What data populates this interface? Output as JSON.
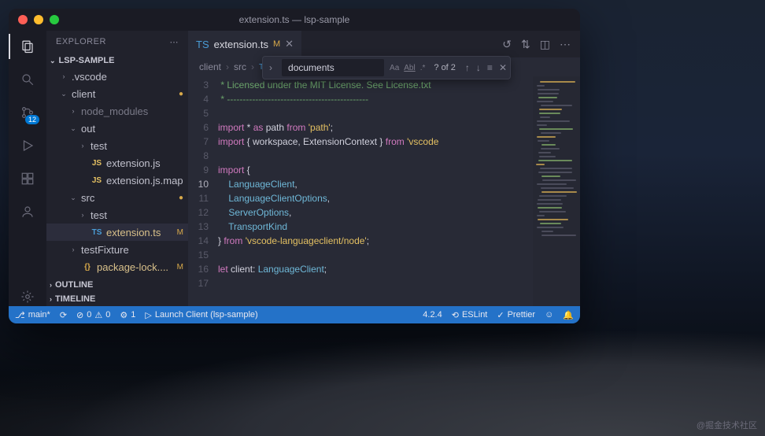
{
  "window": {
    "title": "extension.ts — lsp-sample"
  },
  "explorer": {
    "title": "EXPLORER",
    "project": "LSP-SAMPLE",
    "tree": [
      {
        "depth": 1,
        "chev": "›",
        "label": ".vscode",
        "type": "fld"
      },
      {
        "depth": 1,
        "chev": "⌄",
        "label": "client",
        "type": "fld",
        "mod": true,
        "dot": true
      },
      {
        "depth": 2,
        "chev": "›",
        "label": "node_modules",
        "type": "fld",
        "dim": true
      },
      {
        "depth": 2,
        "chev": "⌄",
        "label": "out",
        "type": "fld"
      },
      {
        "depth": 3,
        "chev": "›",
        "label": "test",
        "type": "fld"
      },
      {
        "depth": 3,
        "icon": "JS",
        "label": "extension.js",
        "type": "js"
      },
      {
        "depth": 3,
        "icon": "JS",
        "label": "extension.js.map",
        "type": "js"
      },
      {
        "depth": 2,
        "chev": "⌄",
        "label": "src",
        "type": "fld",
        "mod": true,
        "dot": true
      },
      {
        "depth": 3,
        "chev": "›",
        "label": "test",
        "type": "fld"
      },
      {
        "depth": 3,
        "icon": "TS",
        "label": "extension.ts",
        "type": "ts",
        "mod": true,
        "sel": true
      },
      {
        "depth": 2,
        "chev": "›",
        "label": "testFixture",
        "type": "fld"
      },
      {
        "depth": 2,
        "icon": "{}",
        "label": "package-lock....",
        "type": "json",
        "mod": true
      }
    ],
    "sections": [
      "OUTLINE",
      "TIMELINE"
    ]
  },
  "tab": {
    "icon": "TS",
    "name": "extension.ts",
    "modified": "M"
  },
  "breadcrumbs": [
    "client",
    "src",
    "extension.ts",
    "..."
  ],
  "find": {
    "value": "documents",
    "count": "? of 2"
  },
  "activity_badge": "12",
  "code": {
    "start": 3,
    "current": 10,
    "lines": [
      [
        {
          "t": " * Licensed under the MIT License. See License.txt",
          "c": "cm"
        }
      ],
      [
        {
          "t": " * ",
          "c": "cm"
        },
        {
          "t": "---------------------------------------------",
          "c": "cm"
        }
      ],
      [],
      [
        {
          "t": "import",
          "c": "kw"
        },
        {
          "t": " * "
        },
        {
          "t": "as",
          "c": "kw"
        },
        {
          "t": " path "
        },
        {
          "t": "from",
          "c": "kw"
        },
        {
          "t": " "
        },
        {
          "t": "'path'",
          "c": "st"
        },
        {
          "t": ";"
        }
      ],
      [
        {
          "t": "import",
          "c": "kw"
        },
        {
          "t": " { workspace, ExtensionContext } "
        },
        {
          "t": "from",
          "c": "kw"
        },
        {
          "t": " "
        },
        {
          "t": "'vscode",
          "c": "st"
        }
      ],
      [],
      [
        {
          "t": "import",
          "c": "kw"
        },
        {
          "t": " {"
        }
      ],
      [
        {
          "t": "    "
        },
        {
          "t": "LanguageClient",
          "c": "ty"
        },
        {
          "t": ","
        }
      ],
      [
        {
          "t": "    "
        },
        {
          "t": "LanguageClientOptions",
          "c": "ty"
        },
        {
          "t": ","
        }
      ],
      [
        {
          "t": "    "
        },
        {
          "t": "ServerOptions",
          "c": "ty"
        },
        {
          "t": ","
        }
      ],
      [
        {
          "t": "    "
        },
        {
          "t": "TransportKind",
          "c": "ty"
        }
      ],
      [
        {
          "t": "} "
        },
        {
          "t": "from",
          "c": "kw"
        },
        {
          "t": " "
        },
        {
          "t": "'vscode-languageclient/node'",
          "c": "st"
        },
        {
          "t": ";"
        }
      ],
      [],
      [
        {
          "t": "let",
          "c": "kw"
        },
        {
          "t": " client: "
        },
        {
          "t": "LanguageClient",
          "c": "ty"
        },
        {
          "t": ";"
        }
      ],
      []
    ]
  },
  "status": {
    "branch": "main*",
    "sync": "⟳",
    "errors": "0",
    "warnings": "0",
    "ports": "1",
    "launch": "Launch Client (lsp-sample)",
    "version": "4.2.4",
    "eslint": "ESLint",
    "prettier": "Prettier"
  },
  "watermark": "@掘金技术社区"
}
